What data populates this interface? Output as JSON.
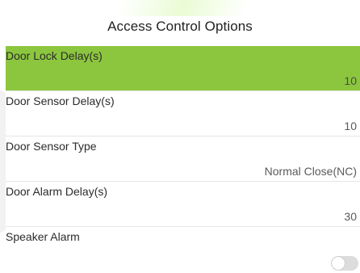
{
  "header": {
    "title": "Access Control Options"
  },
  "items": [
    {
      "label": "Door Lock Delay(s)",
      "value": "10",
      "selected": true
    },
    {
      "label": "Door Sensor Delay(s)",
      "value": "10",
      "selected": false
    },
    {
      "label": "Door Sensor Type",
      "value": "Normal Close(NC)",
      "selected": false
    },
    {
      "label": "Door Alarm Delay(s)",
      "value": "30",
      "selected": false
    },
    {
      "label": "Speaker Alarm",
      "toggle": false,
      "selected": false
    }
  ],
  "colors": {
    "selected_row": "#8cc63f",
    "toggle_off": "#dcdcdc"
  }
}
